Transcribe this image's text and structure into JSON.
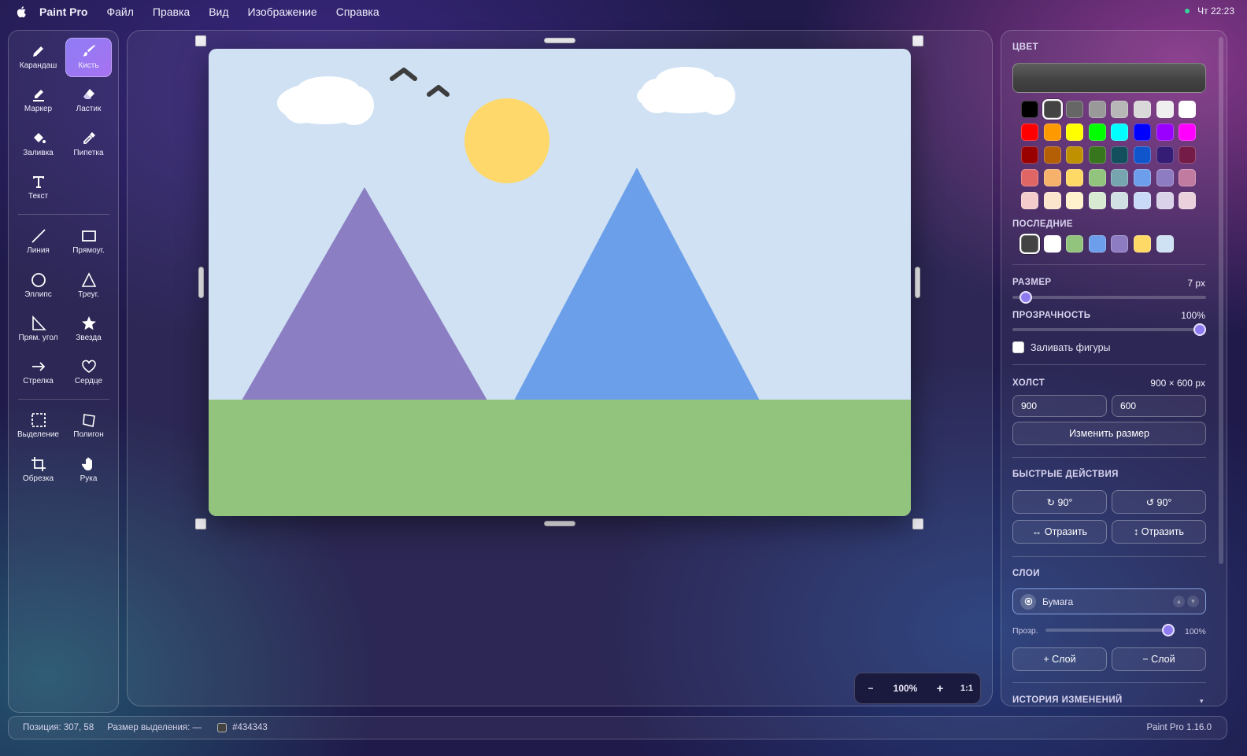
{
  "menubar": {
    "app_name": "Paint Pro",
    "items": [
      "Файл",
      "Правка",
      "Вид",
      "Изображение",
      "Справка"
    ],
    "clock": "Чт 22:23"
  },
  "tools": [
    {
      "label": "Карандаш",
      "icon": "pencil-icon",
      "active": false
    },
    {
      "label": "Кисть",
      "icon": "brush-icon",
      "active": true
    },
    {
      "label": "Маркер",
      "icon": "marker-icon",
      "active": false
    },
    {
      "label": "Ластик",
      "icon": "eraser-icon",
      "active": false
    },
    {
      "label": "Заливка",
      "icon": "bucket-icon",
      "active": false
    },
    {
      "label": "Пипетка",
      "icon": "eyedropper-icon",
      "active": false
    },
    {
      "label": "Текст",
      "icon": "text-icon",
      "active": false
    },
    {
      "label": "Линия",
      "icon": "line-icon",
      "active": false
    },
    {
      "label": "Прямоуг.",
      "icon": "rectangle-icon",
      "active": false
    },
    {
      "label": "Эллипс",
      "icon": "ellipse-icon",
      "active": false
    },
    {
      "label": "Треуг.",
      "icon": "triangle-icon",
      "active": false
    },
    {
      "label": "Прям. угол",
      "icon": "right-triangle-icon",
      "active": false
    },
    {
      "label": "Звезда",
      "icon": "star-icon",
      "active": false
    },
    {
      "label": "Стрелка",
      "icon": "arrow-icon",
      "active": false
    },
    {
      "label": "Сердце",
      "icon": "heart-icon",
      "active": false
    },
    {
      "label": "Выделение",
      "icon": "selection-icon",
      "active": false
    },
    {
      "label": "Полигон",
      "icon": "polygon-icon",
      "active": false
    },
    {
      "label": "Обрезка",
      "icon": "crop-icon",
      "active": false
    },
    {
      "label": "Рука",
      "icon": "hand-icon",
      "active": false
    }
  ],
  "canvas_colors": {
    "sky": "#cfe1f3",
    "cloud": "#ffffff",
    "sun": "#ffd86b",
    "birds": "#3d3d3d",
    "mountain_left": "#8b7ec3",
    "mountain_right": "#6b9fe9",
    "grass": "#92c47d"
  },
  "zoom": {
    "minus": "−",
    "value": "100%",
    "plus": "+",
    "reset": "1:1"
  },
  "panel": {
    "color_title": "ЦВЕТ",
    "current_color": "#434343",
    "palette": [
      [
        "#000000",
        "#434343",
        "#666666",
        "#999999",
        "#b7b7b7",
        "#d9d9d9",
        "#efefef",
        "#ffffff"
      ],
      [
        "#ff0000",
        "#ff9900",
        "#ffff00",
        "#00ff00",
        "#00ffff",
        "#0000ff",
        "#9900ff",
        "#ff00ff"
      ],
      [
        "#990000",
        "#b45f06",
        "#bf9000",
        "#38761d",
        "#134f5c",
        "#1155cc",
        "#351c75",
        "#741b47"
      ],
      [
        "#e06666",
        "#f6b26b",
        "#ffd966",
        "#93c47d",
        "#76a5af",
        "#6d9eeb",
        "#8e7cc3",
        "#c27ba0"
      ],
      [
        "#f4cccc",
        "#fce5cd",
        "#fff2cc",
        "#d9ead3",
        "#d0e0e3",
        "#c9daf8",
        "#d9d2e9",
        "#ead1dc"
      ]
    ],
    "recent_title": "ПОСЛЕДНИЕ",
    "recent": [
      "#434343",
      "#ffffff",
      "#93c47d",
      "#6d9eeb",
      "#8e7cc3",
      "#ffd966",
      "#cfe2f3"
    ],
    "size_title": "РАЗМЕР",
    "size_value": "7 px",
    "size_fraction": 0.04,
    "opacity_title": "ПРОЗРАЧНОСТЬ",
    "opacity_value": "100%",
    "opacity_fraction": 1.0,
    "fill_shapes_label": "Заливать фигуры",
    "canvas_title": "ХОЛСТ",
    "canvas_size": "900 × 600 px",
    "canvas_width": "900",
    "canvas_height": "600",
    "resize_button": "Изменить размер",
    "quick_title": "БЫСТРЫЕ ДЕЙСТВИЯ",
    "rotate_cw": "↻ 90°",
    "rotate_ccw": "↺ 90°",
    "flip_h": "↔ Отразить",
    "flip_v": "↕ Отразить",
    "layers_title": "СЛОИ",
    "layer_name": "Бумага",
    "layer_opacity_label": "Прозр.",
    "layer_opacity_value": "100%",
    "layer_opacity_fraction": 1.0,
    "add_layer": "+ Слой",
    "remove_layer": "− Слой",
    "history_title": "ИСТОРИЯ ИЗМЕНЕНИЙ",
    "history_chevron": "▾"
  },
  "status": {
    "position": "Позиция: 307, 58",
    "selection": "Размер выделения: —",
    "color_hex": "#434343",
    "version": "Paint Pro 1.16.0"
  }
}
